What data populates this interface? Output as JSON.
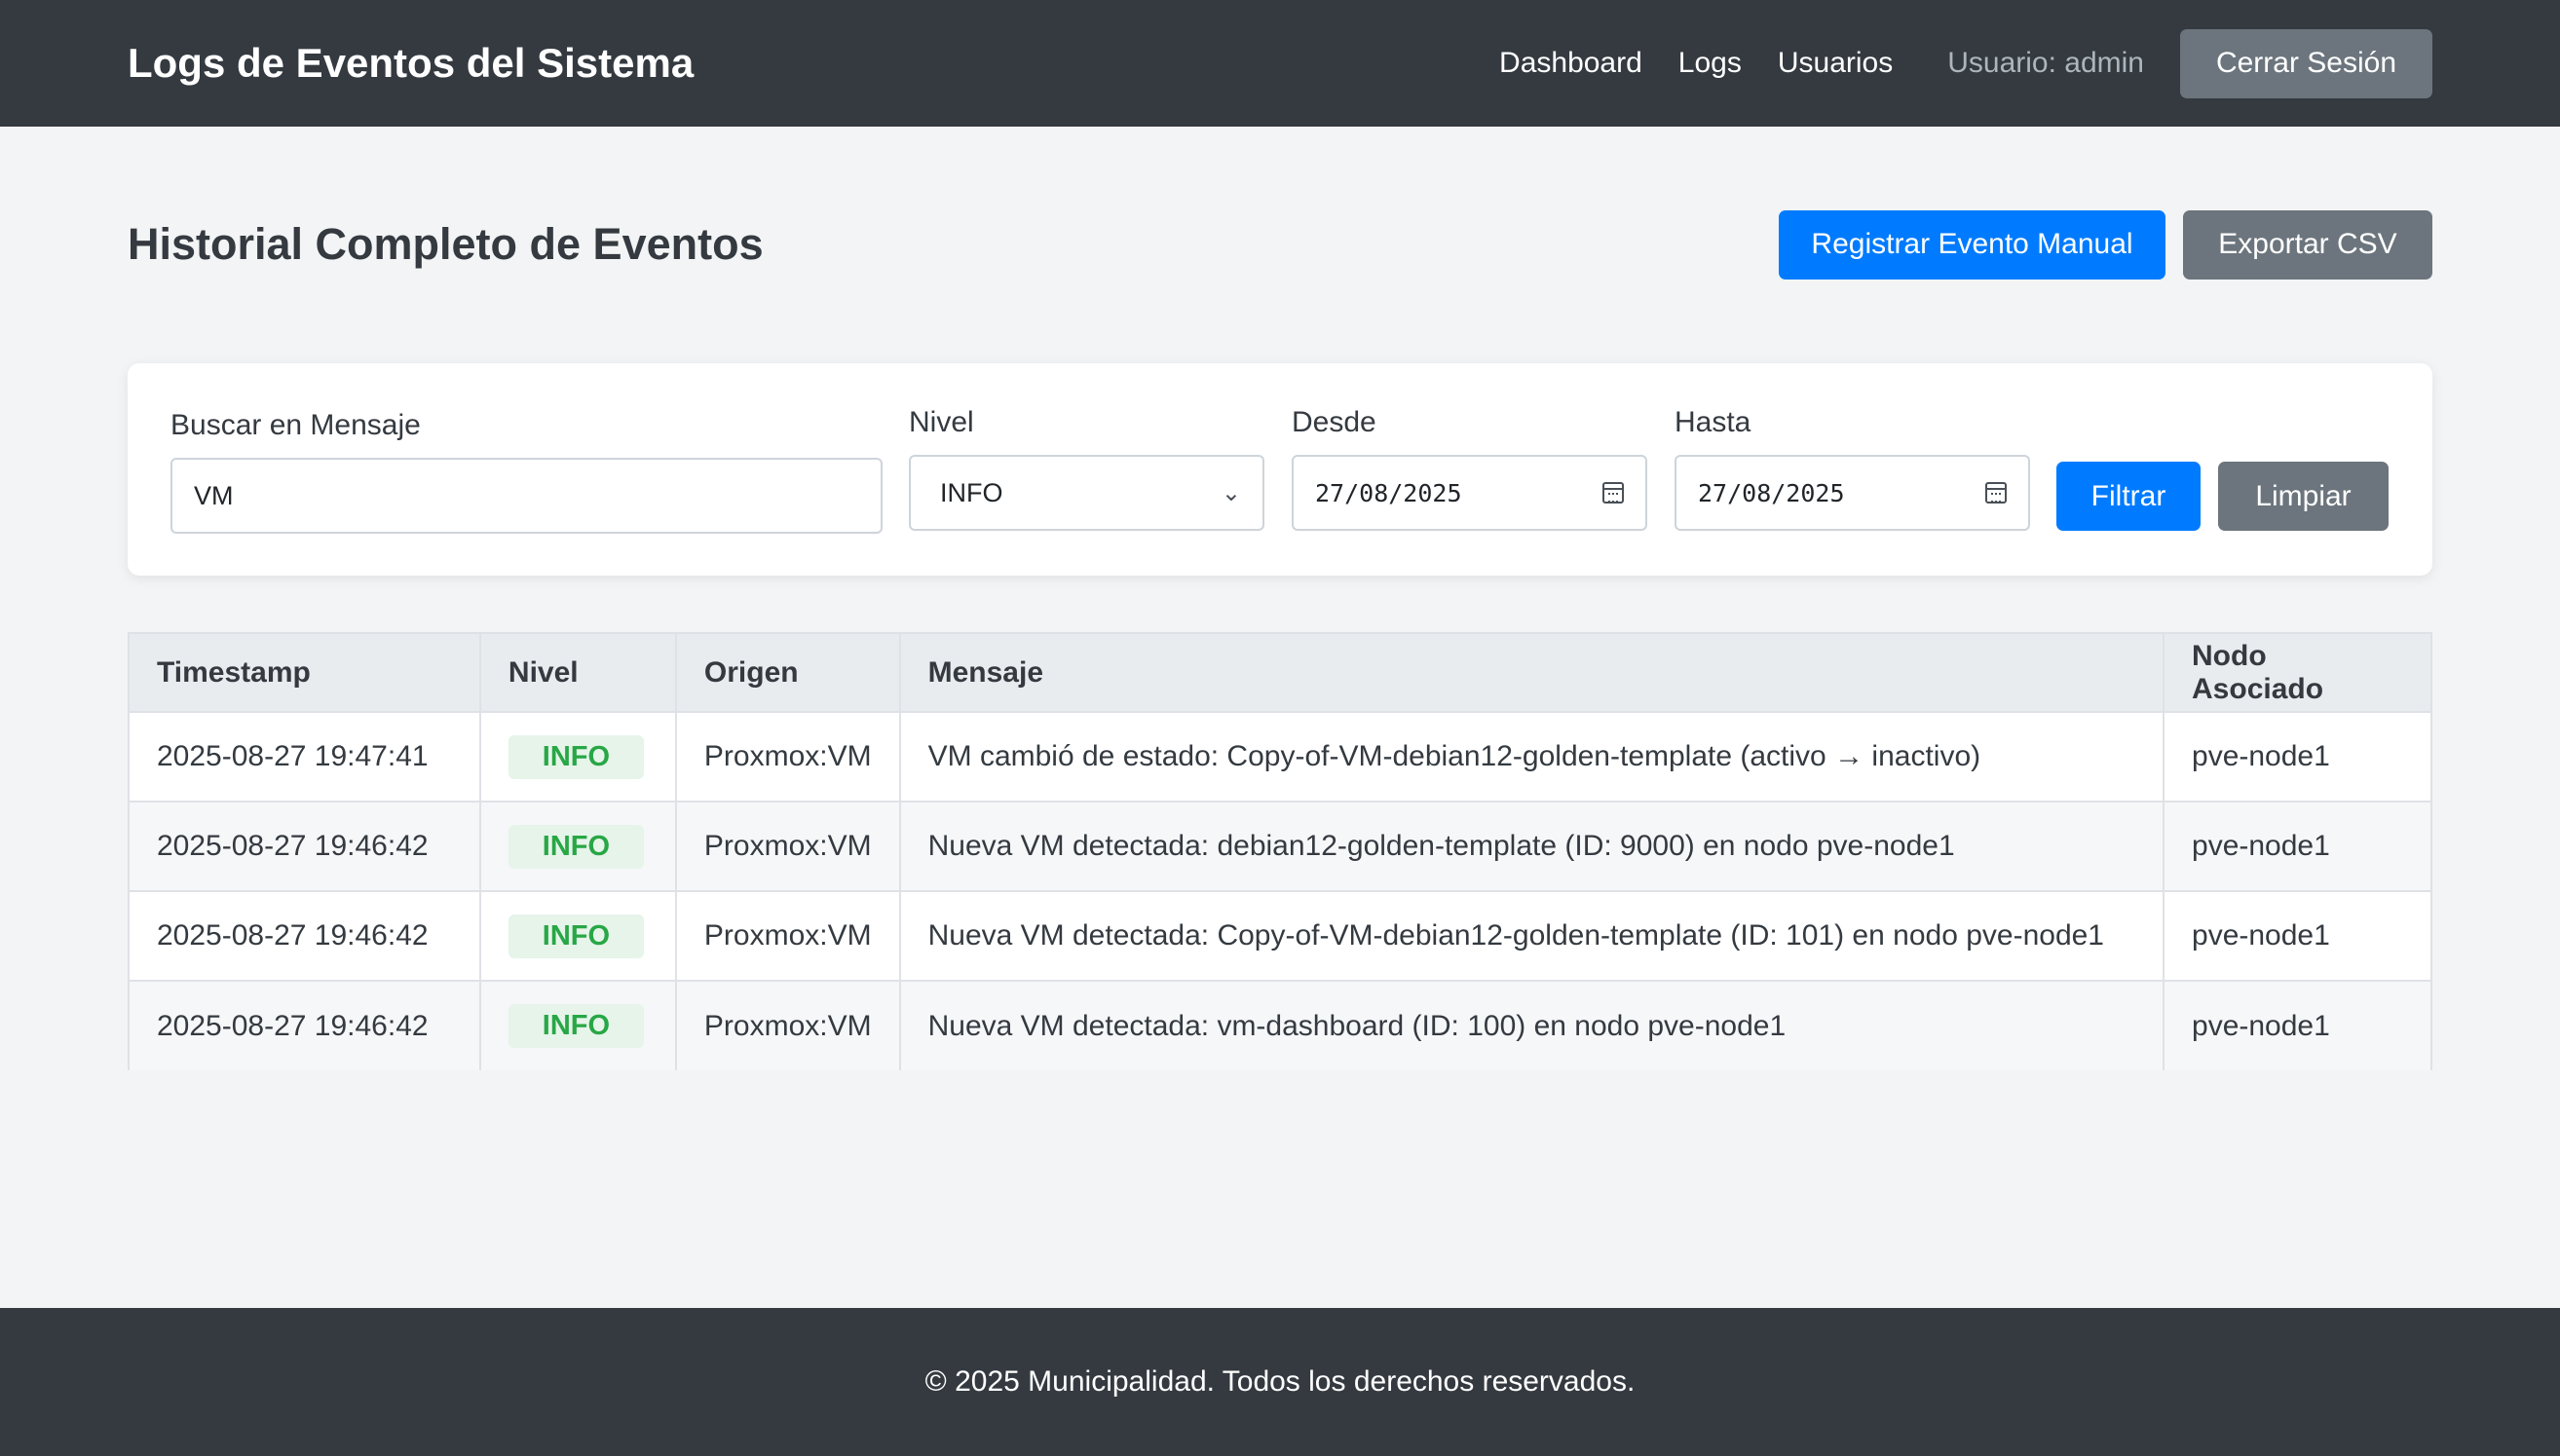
{
  "header": {
    "brand": "Logs de Eventos del Sistema",
    "nav": [
      "Dashboard",
      "Logs",
      "Usuarios"
    ],
    "user_label": "Usuario: admin",
    "logout_label": "Cerrar Sesión"
  },
  "page": {
    "title": "Historial Completo de Eventos",
    "register_label": "Registrar Evento Manual",
    "export_label": "Exportar CSV"
  },
  "filters": {
    "search_label": "Buscar en Mensaje",
    "search_value": "VM",
    "level_label": "Nivel",
    "level_value": "INFO",
    "from_label": "Desde",
    "from_value": "27/08/2025",
    "to_label": "Hasta",
    "to_value": "27/08/2025",
    "filter_label": "Filtrar",
    "clear_label": "Limpiar"
  },
  "table": {
    "headers": [
      "Timestamp",
      "Nivel",
      "Origen",
      "Mensaje",
      "Nodo Asociado"
    ],
    "rows": [
      [
        "2025-08-27 19:47:41",
        "INFO",
        "Proxmox:VM",
        "VM cambió de estado: Copy-of-VM-debian12-golden-template (activo → inactivo)",
        "pve-node1"
      ],
      [
        "2025-08-27 19:46:42",
        "INFO",
        "Proxmox:VM",
        "Nueva VM detectada: debian12-golden-template (ID: 9000) en nodo pve-node1",
        "pve-node1"
      ],
      [
        "2025-08-27 19:46:42",
        "INFO",
        "Proxmox:VM",
        "Nueva VM detectada: Copy-of-VM-debian12-golden-template (ID: 101) en nodo pve-node1",
        "pve-node1"
      ],
      [
        "2025-08-27 19:46:42",
        "INFO",
        "Proxmox:VM",
        "Nueva VM detectada: vm-dashboard (ID: 100) en nodo pve-node1",
        "pve-node1"
      ]
    ]
  },
  "footer": {
    "text": "© 2025 Municipalidad. Todos los derechos reservados."
  },
  "colors": {
    "header_bg": "#343a40",
    "primary": "#007bff",
    "secondary": "#6c757d",
    "info_badge_text": "#28a745",
    "info_badge_bg": "#e6f4ea"
  }
}
